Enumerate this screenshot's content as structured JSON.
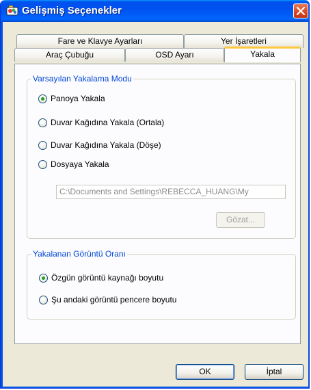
{
  "window": {
    "title": "Gelişmiş Seçenekler",
    "icon": "app-icon",
    "close_icon": "close-icon"
  },
  "tabs": {
    "row1": [
      {
        "label": "Fare ve Klavye Ayarları"
      },
      {
        "label": "Yer İşaretleri"
      }
    ],
    "row2": [
      {
        "label": "Araç Çubuğu"
      },
      {
        "label": "OSD Ayarı"
      },
      {
        "label": "Yakala",
        "active": true
      }
    ]
  },
  "capture_mode": {
    "legend": "Varsayılan Yakalama Modu",
    "options": [
      {
        "label": "Panoya Yakala",
        "selected": true
      },
      {
        "label": "Duvar Kağıdına Yakala (Ortala)",
        "selected": false
      },
      {
        "label": "Duvar Kağıdına Yakala (Döşe)",
        "selected": false
      },
      {
        "label": "Dosyaya Yakala",
        "selected": false
      }
    ],
    "path_value": "C:\\Documents and Settings\\REBECCA_HUANG\\My",
    "browse_label": "Gözat..."
  },
  "ratio": {
    "legend": "Yakalanan Görüntü Oranı",
    "options": [
      {
        "label": "Özgün görüntü kaynağı boyutu",
        "selected": true
      },
      {
        "label": "Şu andaki görüntü pencere boyutu",
        "selected": false
      }
    ]
  },
  "footer": {
    "ok_label": "OK",
    "cancel_label": "İptal"
  },
  "colors": {
    "titlebar": "#0055e5",
    "accent_tab": "#ffc83c",
    "legend_text": "#0046d5",
    "radio_dot": "#21a121"
  }
}
